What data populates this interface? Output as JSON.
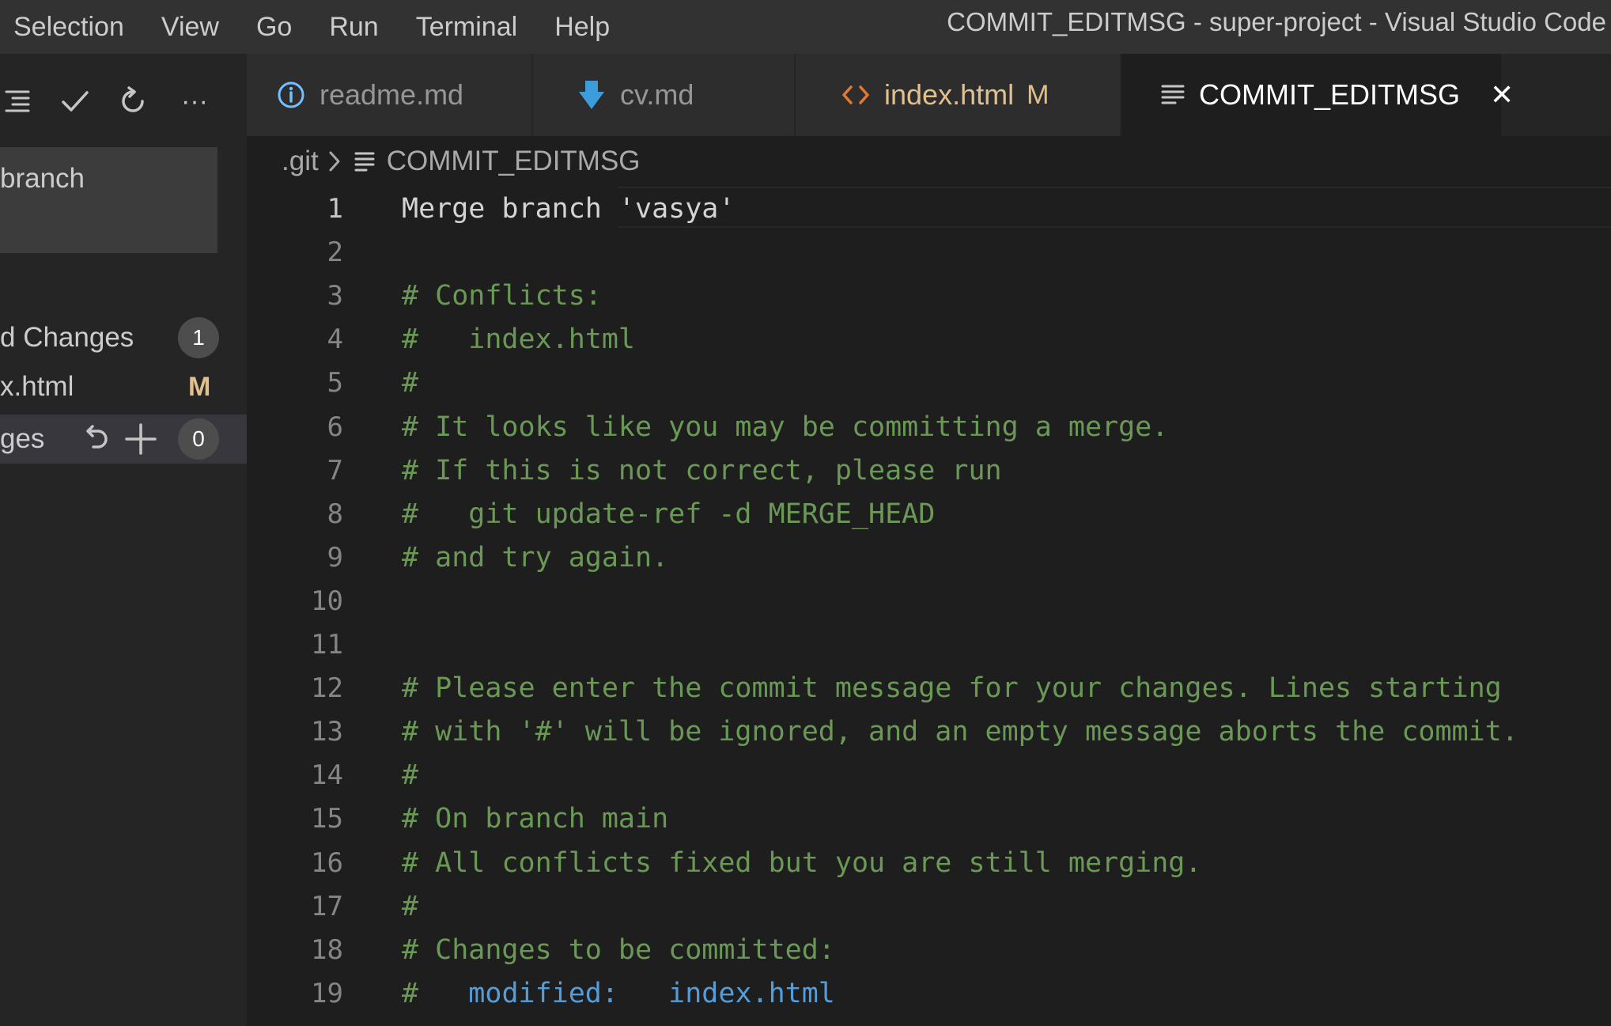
{
  "menu": {
    "items": [
      "Selection",
      "View",
      "Go",
      "Run",
      "Terminal",
      "Help"
    ],
    "window_title": "COMMIT_EDITMSG - super-project - Visual Studio Code"
  },
  "sidebar": {
    "toolbar": {
      "icons": [
        "view-as-tree-icon",
        "commit-check-icon",
        "refresh-icon",
        "more-actions-icon"
      ],
      "more_label": "···"
    },
    "commit_message_box": {
      "text": "branch"
    },
    "staged_changes": {
      "label": "d Changes",
      "count": "1"
    },
    "staged_file": {
      "name": "x.html",
      "status": "M"
    },
    "changes": {
      "label": "ges",
      "count": "0",
      "icons": [
        "discard-icon",
        "stage-all-icon"
      ]
    }
  },
  "tabs": [
    {
      "label": "readme.md",
      "icon": "info-icon",
      "status": "",
      "active": false
    },
    {
      "label": "cv.md",
      "icon": "markdown-down-arrow-icon",
      "status": "",
      "active": false
    },
    {
      "label": "index.html",
      "icon": "html-code-icon",
      "status": "M",
      "active": false
    },
    {
      "label": "COMMIT_EDITMSG",
      "icon": "lines-icon",
      "status": "",
      "active": true,
      "close_icon": "close-icon",
      "close_label": "✕"
    }
  ],
  "breadcrumb": {
    "folder": ".git",
    "file": "COMMIT_EDITMSG",
    "file_icon": "lines-icon"
  },
  "colors": {
    "background": "#1e1e1e",
    "comment": "#6a9955",
    "keyword": "#569cd6",
    "modified": "#e2c08d"
  },
  "editor": {
    "current_line": 1,
    "lines": [
      {
        "n": "1",
        "tokens": [
          {
            "t": "Merge branch 'vasya'",
            "c": "text"
          }
        ]
      },
      {
        "n": "2",
        "tokens": []
      },
      {
        "n": "3",
        "tokens": [
          {
            "t": "# Conflicts:",
            "c": "comment"
          }
        ]
      },
      {
        "n": "4",
        "tokens": [
          {
            "t": "#   index.html",
            "c": "comment"
          }
        ]
      },
      {
        "n": "5",
        "tokens": [
          {
            "t": "#",
            "c": "comment"
          }
        ]
      },
      {
        "n": "6",
        "tokens": [
          {
            "t": "# It looks like you may be committing a merge.",
            "c": "comment"
          }
        ]
      },
      {
        "n": "7",
        "tokens": [
          {
            "t": "# If this is not correct, please run",
            "c": "comment"
          }
        ]
      },
      {
        "n": "8",
        "tokens": [
          {
            "t": "#   git update-ref -d MERGE_HEAD",
            "c": "comment"
          }
        ]
      },
      {
        "n": "9",
        "tokens": [
          {
            "t": "# and try again.",
            "c": "comment"
          }
        ]
      },
      {
        "n": "10",
        "tokens": []
      },
      {
        "n": "11",
        "tokens": []
      },
      {
        "n": "12",
        "tokens": [
          {
            "t": "# Please enter the commit message for your changes. Lines starting",
            "c": "comment"
          }
        ]
      },
      {
        "n": "13",
        "tokens": [
          {
            "t": "# with '#' will be ignored, and an empty message aborts the commit.",
            "c": "comment"
          }
        ]
      },
      {
        "n": "14",
        "tokens": [
          {
            "t": "#",
            "c": "comment"
          }
        ]
      },
      {
        "n": "15",
        "tokens": [
          {
            "t": "# On branch main",
            "c": "comment"
          }
        ]
      },
      {
        "n": "16",
        "tokens": [
          {
            "t": "# All conflicts fixed but you are still merging.",
            "c": "comment"
          }
        ]
      },
      {
        "n": "17",
        "tokens": [
          {
            "t": "#",
            "c": "comment"
          }
        ]
      },
      {
        "n": "18",
        "tokens": [
          {
            "t": "# Changes to be committed:",
            "c": "comment"
          }
        ]
      },
      {
        "n": "19",
        "tokens": [
          {
            "t": "#   ",
            "c": "comment"
          },
          {
            "t": "modified:   index.html",
            "c": "keyword"
          }
        ]
      }
    ]
  }
}
